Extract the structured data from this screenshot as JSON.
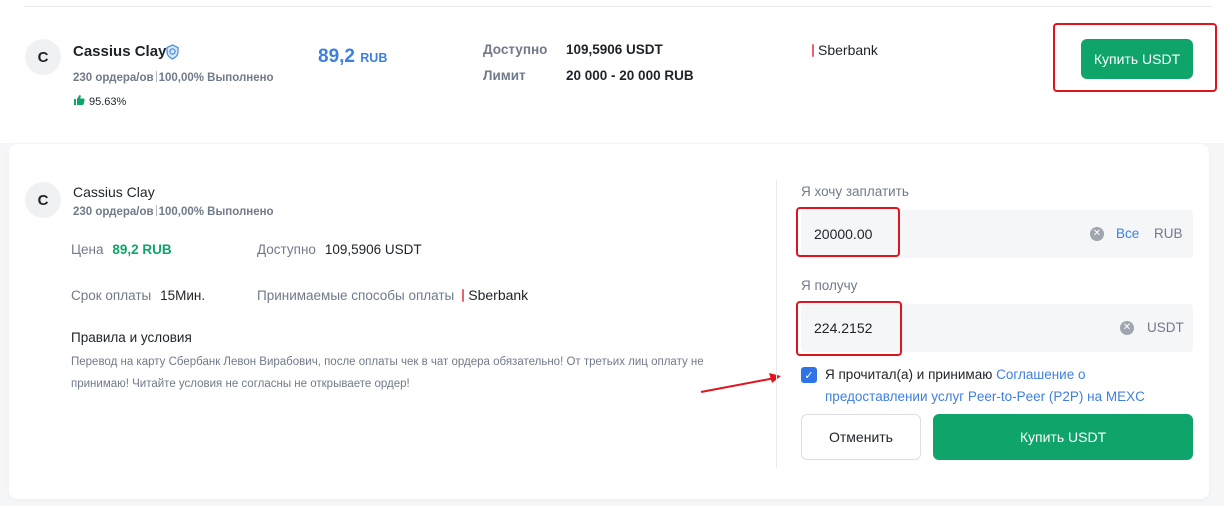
{
  "offer": {
    "avatar_letter": "C",
    "merchant_name": "Cassius Clay",
    "orders_text": "230 ордера/ов",
    "completion_text": "100,00% Выполнено",
    "positive_rate": "95.63%",
    "price_value": "89,2",
    "price_currency": "RUB",
    "available_label": "Доступно",
    "available_value": "109,5906 USDT",
    "limit_label": "Лимит",
    "limit_value": "20 000 - 20 000 RUB",
    "payment_method": "Sberbank",
    "buy_button_label": "Купить USDT"
  },
  "detail": {
    "avatar_letter": "C",
    "merchant_name": "Cassius Clay",
    "orders_text": "230 ордера/ов",
    "completion_text": "100,00% Выполнено",
    "price_label": "Цена",
    "price_value": "89,2 RUB",
    "available_label": "Доступно",
    "available_value": "109,5906 USDT",
    "payment_term_label": "Срок оплаты",
    "payment_term_value": "15Мин.",
    "accepted_methods_label": "Принимаемые способы оплаты",
    "payment_method": "Sberbank",
    "rules_title": "Правила и условия",
    "rules_text": "Перевод на карту Сбербанк Левон Вирабович, после оплаты чек в чат ордера обязательно! От третьих лиц оплату не принимаю! Читайте условия не согласны не открываете ордер!"
  },
  "form": {
    "pay_label": "Я хочу заплатить",
    "pay_value": "20000.00",
    "pay_all_link": "Все",
    "pay_currency": "RUB",
    "receive_label": "Я получу",
    "receive_value": "224.2152",
    "receive_currency": "USDT",
    "agree_text": "Я прочитал(а) и принимаю",
    "agree_link": "Соглашение о предоставлении услуг Peer-to-Peer (P2P) на MEXC",
    "cancel_label": "Отменить",
    "buy_label": "Купить  USDT",
    "checkbox_checked": true
  },
  "colors": {
    "accent_green": "#0ea46a",
    "link_blue": "#3e7fe0",
    "highlight_red": "#e0141e",
    "checkbox_blue": "#2f74e6"
  },
  "icons": {
    "verified": "verified-badge-icon",
    "thumb": "thumbs-up-icon",
    "clear": "clear-icon",
    "check": "checkmark-icon"
  }
}
